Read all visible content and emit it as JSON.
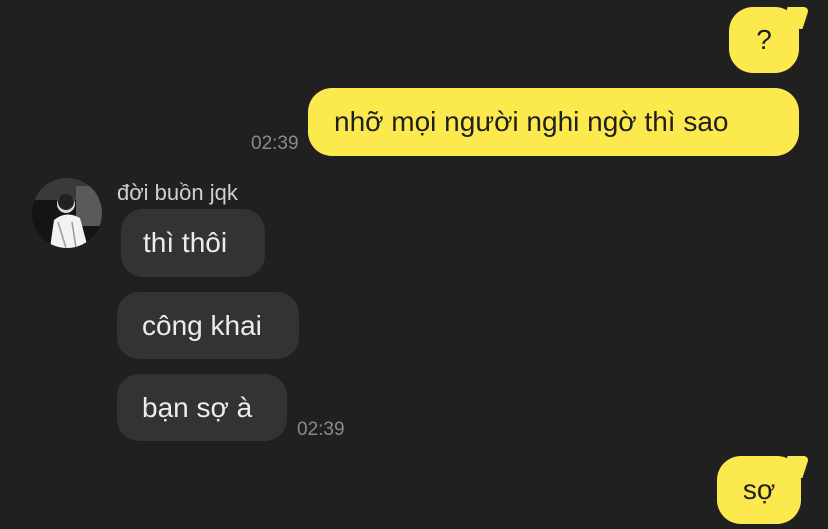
{
  "messages": {
    "out1": {
      "text": "?"
    },
    "out2": {
      "text": "nhỡ mọi người nghi ngờ thì sao",
      "time": "02:39"
    },
    "sender": {
      "name": "đời buồn jqk",
      "avatar_icon": "user-photo-avatar-icon"
    },
    "in1": {
      "text": "thì thôi"
    },
    "in2": {
      "text": "công khai"
    },
    "in3": {
      "text": "bạn sợ à",
      "time": "02:39"
    },
    "out3": {
      "text": "sợ"
    }
  },
  "colors": {
    "background": "#202020",
    "outgoing_bubble": "#fbe94e",
    "incoming_bubble": "#333333",
    "timestamp": "#8a8a8a"
  }
}
